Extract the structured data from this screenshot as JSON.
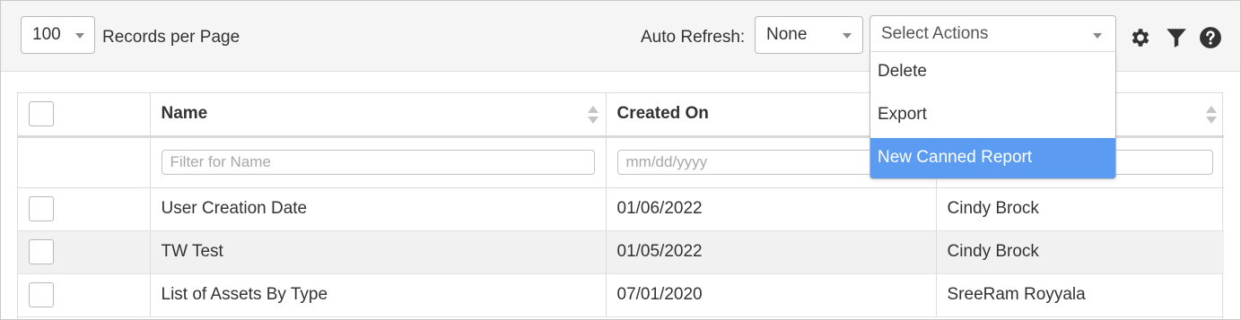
{
  "toolbar": {
    "records_per_page_value": "100",
    "records_per_page_label": "Records per Page",
    "auto_refresh_label": "Auto Refresh:",
    "auto_refresh_value": "None",
    "actions_placeholder": "Select Actions",
    "icons": [
      "gear-icon",
      "filter-icon",
      "help-icon"
    ]
  },
  "actions_menu": {
    "items": [
      {
        "label": "Delete"
      },
      {
        "label": "Export"
      },
      {
        "label": "New Canned Report"
      }
    ],
    "highlighted": "New Canned Report",
    "highlight_color": "#5b9cf2"
  },
  "table": {
    "columns": [
      "",
      "Name",
      "Created On",
      ""
    ],
    "filters": {
      "name_placeholder": "Filter for Name",
      "date_placeholder": "mm/dd/yyyy",
      "creator_placeholder": ""
    },
    "rows": [
      {
        "name": "User Creation Date",
        "created_on": "01/06/2022",
        "created_by": "Cindy Brock"
      },
      {
        "name": "TW Test",
        "created_on": "01/05/2022",
        "created_by": "Cindy Brock"
      },
      {
        "name": "List of Assets By Type",
        "created_on": "07/01/2020",
        "created_by": "SreeRam Royyala"
      }
    ]
  }
}
